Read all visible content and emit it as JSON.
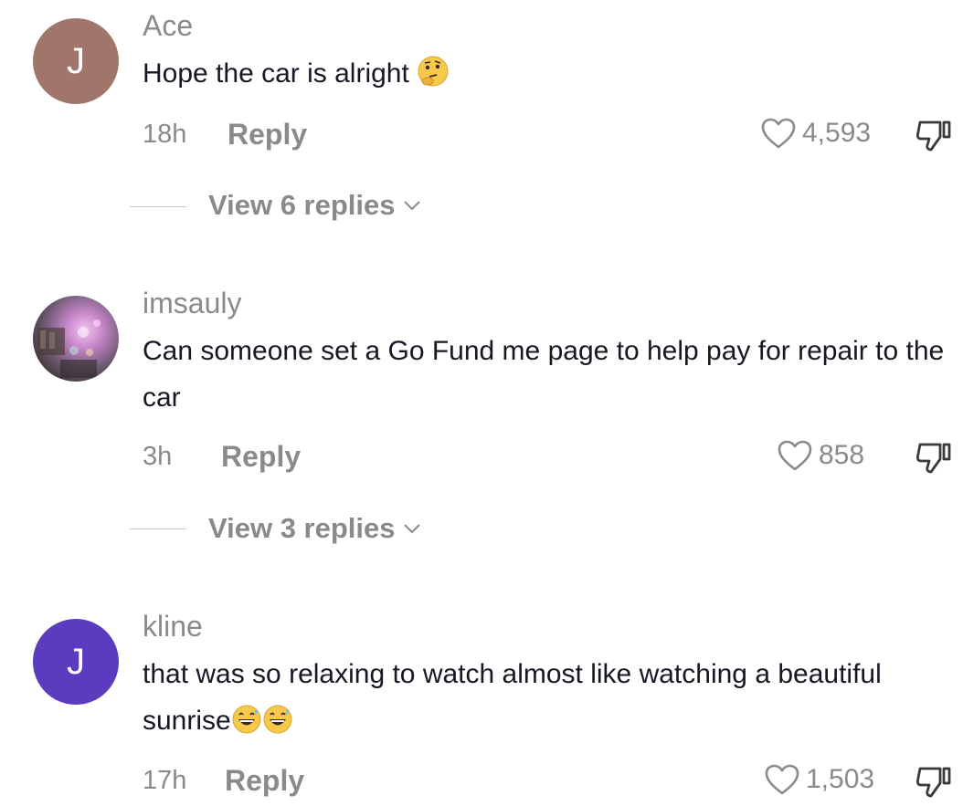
{
  "comments": [
    {
      "username": "Ace",
      "avatar_letter": "J",
      "avatar_color": "#a0766b",
      "text": "Hope the car is alright",
      "emoji": "thinking-face",
      "time": "18h",
      "reply_label": "Reply",
      "likes": "4,593",
      "view_replies": "View 6 replies"
    },
    {
      "username": "imsauly",
      "avatar_type": "photo",
      "text": "Can someone set a Go Fund me page to help pay for repair to the car",
      "time": "3h",
      "reply_label": "Reply",
      "likes": "858",
      "view_replies": "View 3 replies"
    },
    {
      "username": "kline",
      "avatar_letter": "J",
      "avatar_color": "#5b3cbf",
      "text": "that was so relaxing to watch almost like watching a beautiful sunrise",
      "emoji": "grinning-sweat-face x2",
      "time": "17h",
      "reply_label": "Reply",
      "likes": "1,503"
    }
  ],
  "colors": {
    "secondary_text": "#8a8a8e",
    "primary_text": "#161823"
  }
}
